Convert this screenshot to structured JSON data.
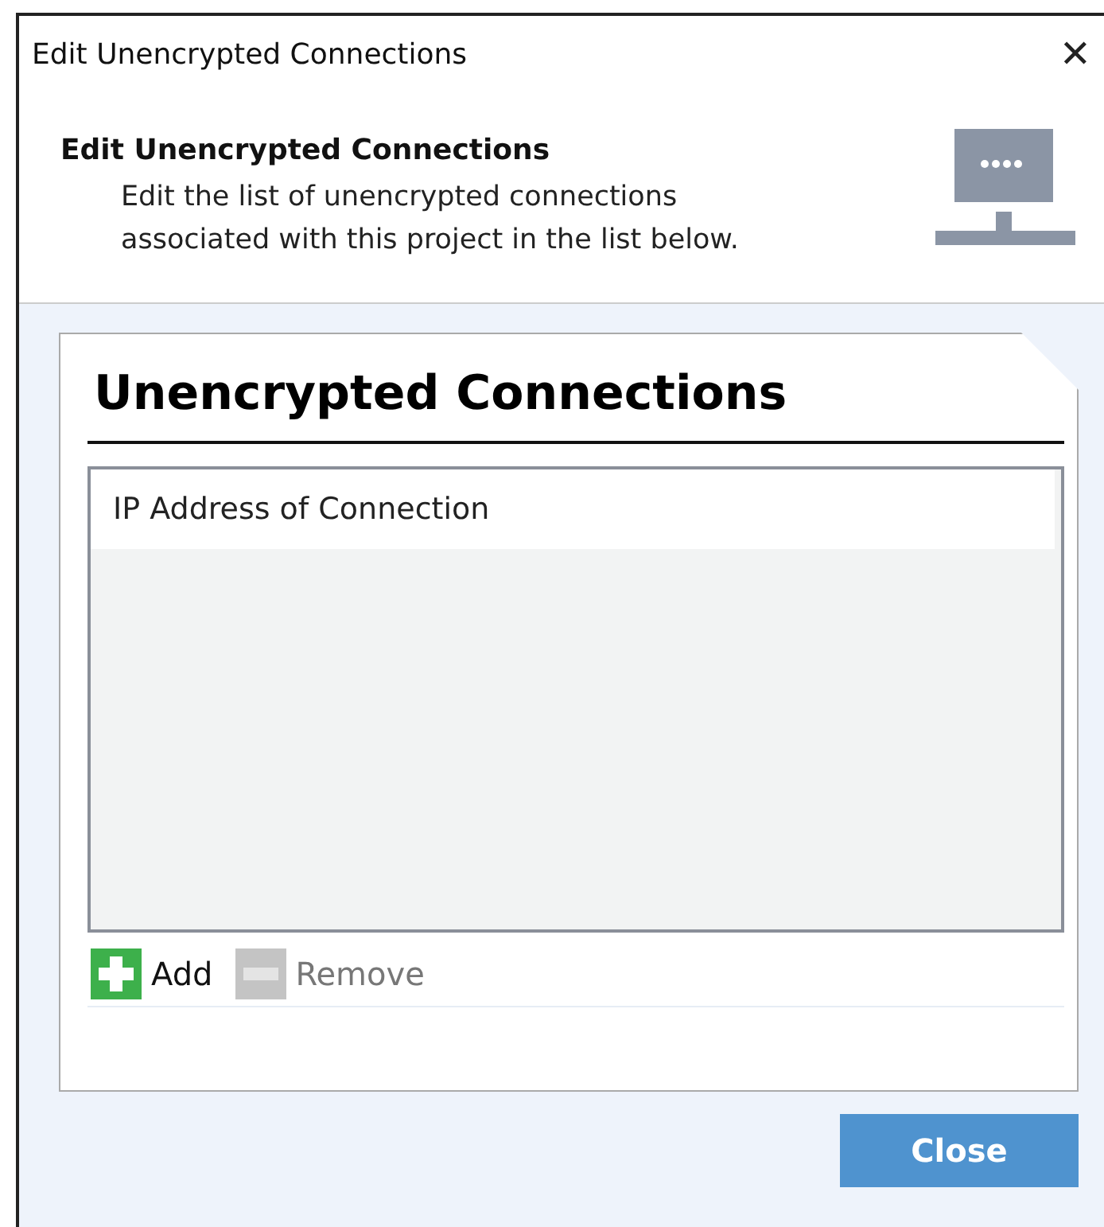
{
  "window": {
    "title": "Edit Unencrypted Connections",
    "close_glyph": "✕"
  },
  "header": {
    "title": "Edit Unencrypted Connections",
    "description": "Edit the list of unencrypted connections associated with this project in the list below."
  },
  "panel": {
    "title": "Unencrypted Connections",
    "columns": [
      "IP Address of Connection"
    ],
    "actions": [
      {
        "kind": "add",
        "label": "Add",
        "disabled": false
      },
      {
        "kind": "remove",
        "label": "Remove",
        "disabled": true
      }
    ]
  },
  "buttons": [
    "Close"
  ]
}
